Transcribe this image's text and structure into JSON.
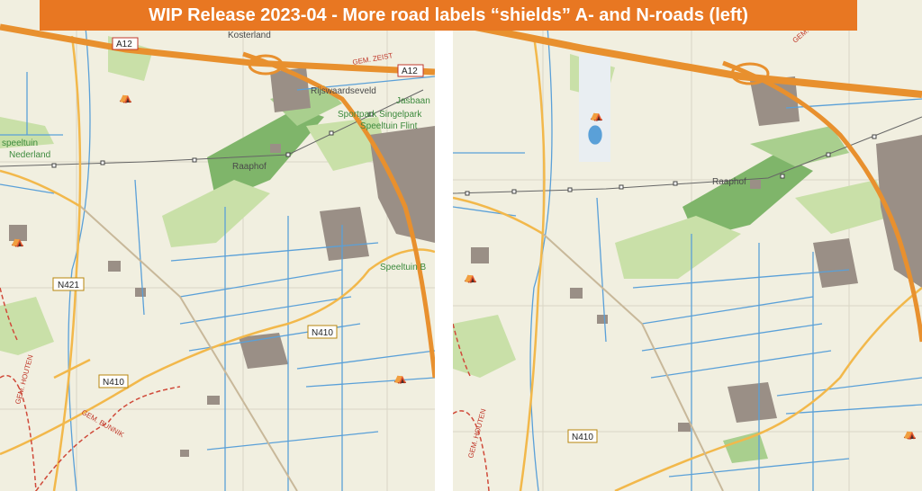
{
  "banner": {
    "title": "WIP Release 2023-04 - More road labels “shields” A- and N-roads (left)"
  },
  "left_map": {
    "shields": [
      "A12",
      "A12",
      "N421",
      "N410",
      "N410"
    ],
    "places": [
      "Kosterland",
      "Rijswaardseveld",
      "Sportpark Singelpark",
      "Speeltuin Flint",
      "speeltuin",
      "Nederland",
      "Raaphof",
      "Speeltuin B",
      "Jasbaan"
    ],
    "municipalities": [
      "GEM. ZEIST",
      "GEM. HOUTEN",
      "GEM. BUNNIK"
    ]
  },
  "right_map": {
    "shields": [
      "N410"
    ],
    "places": [
      "Raaphof"
    ],
    "municipalities": [
      "GEM.",
      "GEM. HOUTEN"
    ]
  },
  "colors": {
    "banner": "#e87722",
    "land": "#f1efe0",
    "motorway": "#e8902e",
    "secondary_road": "#f2b84b",
    "water": "#5aa0d8",
    "forest": "#7fb56a",
    "grass": "#c9e0a8",
    "built": "#9a8f86",
    "municipal_border": "#d04a3a"
  }
}
